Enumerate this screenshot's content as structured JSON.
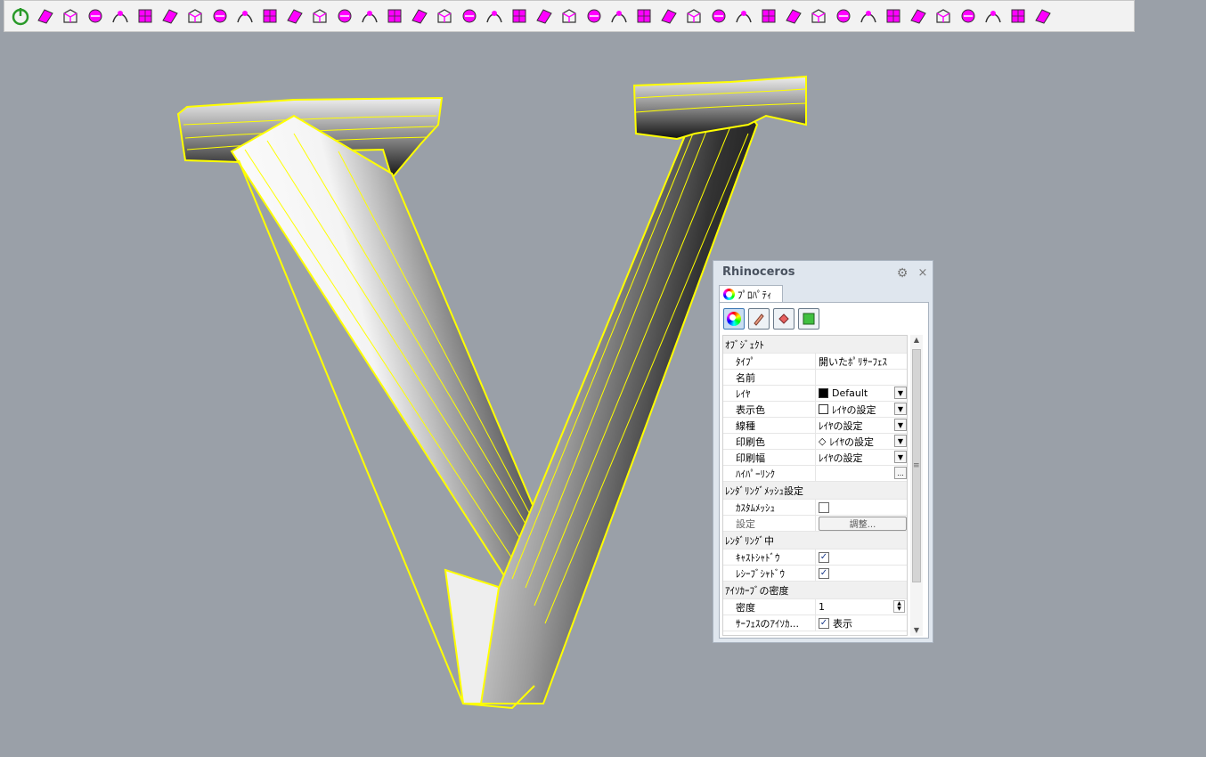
{
  "toolbar": {
    "icons": [
      "power-icon",
      "layer-box-icon",
      "mesh-box-icon",
      "surface-icon",
      "mesh-grid-icon",
      "box-icon",
      "curve-arrow-icon",
      "blend-icon",
      "transform-icon",
      "loft-icon",
      "arch-icon",
      "rotate-icon",
      "extrude-icon",
      "extract-icon",
      "split-icon",
      "explode-icon",
      "fillet-icon",
      "network-icon",
      "checkbox-grid-icon",
      "grid-icon",
      "pipe-icon",
      "delete-points-icon",
      "array-icon",
      "match-icon",
      "offset-icon",
      "ring-icon",
      "points-grid-icon",
      "rebuild-icon",
      "edit-icon",
      "split-point-icon",
      "tree-icon",
      "flip-icon",
      "target-icon",
      "gear-star-icon",
      "pentagon-icon",
      "stairs-icon",
      "map-icon",
      "plane-icon",
      "tile-icon",
      "scissors-icon",
      "cube-icon",
      "settings-icon"
    ]
  },
  "panel": {
    "title": "Rhinoceros",
    "tab_label": "ﾌﾟﾛﾊﾟﾃｨ",
    "sections": {
      "object": "ｵﾌﾞｼﾞｪｸﾄ",
      "render_mesh": "ﾚﾝﾀﾞﾘﾝｸﾞﾒｯｼｭ設定",
      "rendering": "ﾚﾝﾀﾞﾘﾝｸﾞ中",
      "isocurve": "ｱｲｿｶｰﾌﾞの密度"
    },
    "rows": {
      "type_label": "ﾀｲﾌﾟ",
      "type_value": "開いたﾎﾟﾘｻｰﾌｪｽ",
      "name_label": "名前",
      "name_value": "",
      "layer_label": "ﾚｲﾔ",
      "layer_value": "Default",
      "display_color_label": "表示色",
      "display_color_value": "ﾚｲﾔの設定",
      "linetype_label": "線種",
      "linetype_value": "ﾚｲﾔの設定",
      "print_color_label": "印刷色",
      "print_color_value": "ﾚｲﾔの設定",
      "print_width_label": "印刷幅",
      "print_width_value": "ﾚｲﾔの設定",
      "hyperlink_label": "ﾊｲﾊﾟｰﾘﾝｸ",
      "hyperlink_button": "...",
      "custom_mesh_label": "ｶｽﾀﾑﾒｯｼｭ",
      "settings_label": "設定",
      "adjust_button": "調整...",
      "cast_shadow_label": "ｷｬｽﾄｼｬﾄﾞｳ",
      "receive_shadow_label": "ﾚｼｰﾌﾞｼｬﾄﾞｳ",
      "density_label": "密度",
      "density_value": "1",
      "surface_iso_label": "ｻｰﾌｪｽのｱｲｿｶ...",
      "surface_iso_value": "表示"
    },
    "checks": {
      "custom_mesh": false,
      "cast_shadow": true,
      "receive_shadow": true,
      "surface_iso": true
    }
  },
  "colors": {
    "background": "#9aa0a8",
    "wireframe": "#ffff00",
    "accent_magenta": "#ff00ff"
  }
}
